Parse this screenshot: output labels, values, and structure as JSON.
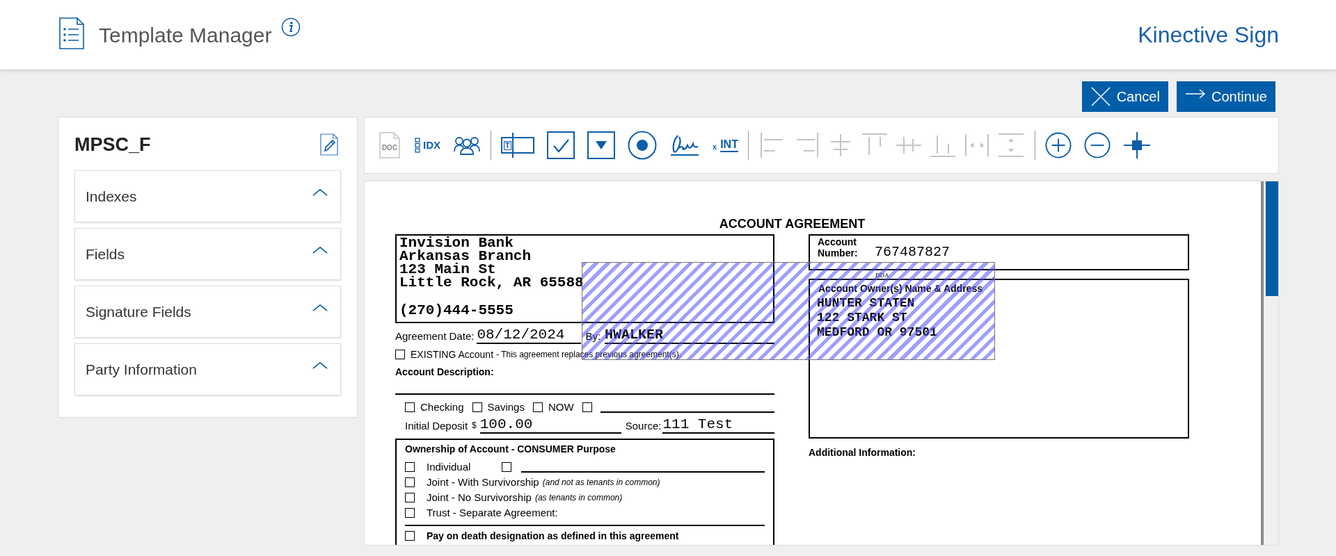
{
  "header": {
    "title": "Template Manager",
    "brand": "Kinective Sign"
  },
  "actions": [
    {
      "kind": "cancel",
      "label": "Cancel"
    },
    {
      "kind": "continue",
      "label": "Continue"
    }
  ],
  "sidebar": {
    "title": "MPSC_F",
    "sections": [
      {
        "label": "Indexes",
        "expanded": true
      },
      {
        "label": "Fields",
        "expanded": true
      },
      {
        "label": "Signature Fields",
        "expanded": true
      },
      {
        "label": "Party Information",
        "expanded": true
      }
    ]
  },
  "toolbar": {
    "groups": [
      [
        {
          "kind": "doc",
          "label": "DOC",
          "disabled": true
        },
        {
          "kind": "idx",
          "label": "IDX",
          "disabled": false
        },
        {
          "kind": "parties",
          "disabled": false
        }
      ],
      [
        {
          "kind": "text",
          "label": "T",
          "disabled": false
        },
        {
          "kind": "checkbox",
          "disabled": false
        },
        {
          "kind": "dropdown",
          "disabled": false
        },
        {
          "kind": "radio",
          "disabled": false
        },
        {
          "kind": "signature",
          "disabled": false
        },
        {
          "kind": "initials",
          "prefix": "x",
          "label": "INT",
          "disabled": false
        }
      ],
      [
        {
          "kind": "align-left",
          "disabled": true
        },
        {
          "kind": "align-right",
          "disabled": true
        },
        {
          "kind": "align-center",
          "disabled": true
        },
        {
          "kind": "align-top",
          "disabled": true
        },
        {
          "kind": "align-middle",
          "disabled": true
        },
        {
          "kind": "align-bottom",
          "disabled": true
        },
        {
          "kind": "space-h",
          "disabled": true
        },
        {
          "kind": "space-v",
          "disabled": true
        }
      ],
      [
        {
          "kind": "zoom-in",
          "disabled": false
        },
        {
          "kind": "zoom-out",
          "disabled": false
        },
        {
          "kind": "crosshair",
          "disabled": false
        }
      ]
    ]
  },
  "document": {
    "title": "ACCOUNT AGREEMENT",
    "bank": {
      "lines": [
        "Invision Bank",
        "Arkansas Branch",
        "123 Main St",
        "Little Rock, AR 65588"
      ],
      "phone": "(270)444-5555"
    },
    "agreement_date": {
      "label": "Agreement Date:",
      "value": "08/12/2024"
    },
    "by": {
      "label": "By:",
      "value": "HWALKER"
    },
    "existing": {
      "label": "EXISTING Account",
      "note": "- This agreement replaces previous agreement(s).",
      "checked": false
    },
    "description_label": "Account Description:",
    "account_types": [
      {
        "kind": "labeled",
        "label": "Checking",
        "checked": false
      },
      {
        "kind": "labeled",
        "label": "Savings",
        "checked": false
      },
      {
        "kind": "labeled",
        "label": "NOW",
        "checked": false
      },
      {
        "kind": "blank",
        "checked": false
      }
    ],
    "initial_deposit": {
      "label": "Initial Deposit",
      "currency": "$",
      "value": "100.00"
    },
    "source": {
      "label": "Source:",
      "value": "111 Test"
    },
    "ownership": {
      "title": "Ownership of Account - CONSUMER Purpose",
      "options": [
        {
          "label": "Individual",
          "checked": false,
          "blank": {
            "checked": false
          }
        },
        {
          "label": "Joint - With Survivorship",
          "note": "(and not as tenants in common)",
          "checked": false
        },
        {
          "label": "Joint - No Survivorship",
          "note": "(as tenants in common)",
          "checked": false
        },
        {
          "label": "Trust - Separate Agreement:",
          "checked": false
        }
      ],
      "pod": {
        "label": "Pay on death designation as defined in this agreement",
        "checked": false
      }
    },
    "account_number": {
      "label": "Account Number:",
      "value": "767487827",
      "sublabel": "DDA"
    },
    "owner": {
      "label": "Account Owner(s) Name & Address",
      "lines": [
        "HUNTER STATEN",
        "122 STARK ST",
        "MEDFORD OR 97501"
      ]
    },
    "additional_label": "Additional Information:"
  }
}
